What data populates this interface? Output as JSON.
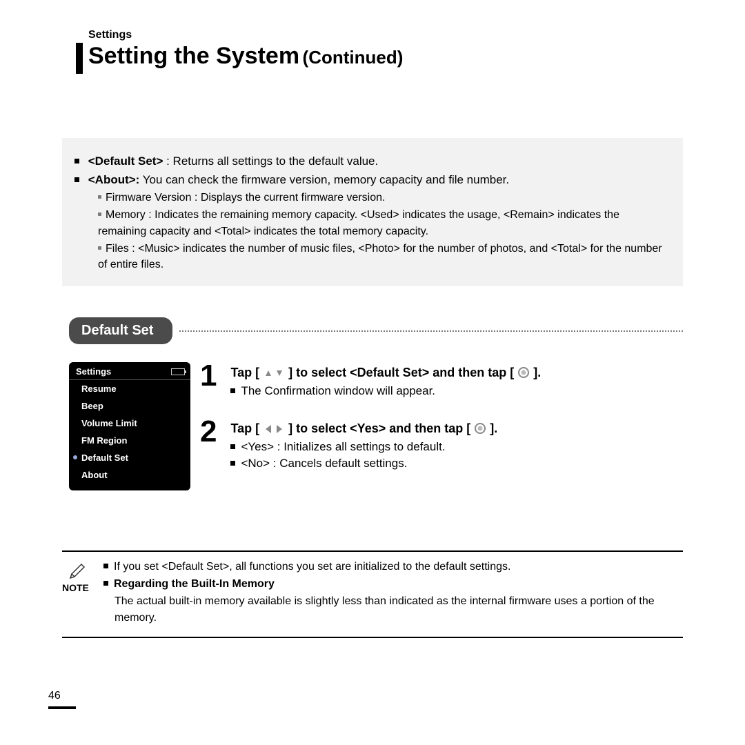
{
  "header": {
    "section_label": "Settings",
    "title_main": "Setting the System",
    "title_continued": "(Continued)"
  },
  "info_box": {
    "items": [
      {
        "bold": "<Default Set>",
        "plain": " : Returns all settings to the default value."
      },
      {
        "bold": "<About>:",
        "plain": " You can check the firmware version, memory capacity and file number."
      }
    ],
    "sub_items": [
      "Firmware Version : Displays the current firmware version.",
      "Memory : Indicates the remaining memory capacity. <Used> indicates the usage, <Remain> indicates the remaining capacity and <Total> indicates the total memory capacity.",
      "Files : <Music> indicates the number of music files, <Photo> for the number of photos, and <Total> for the number of entire files."
    ]
  },
  "section_tab": "Default Set",
  "device": {
    "title": "Settings",
    "items": [
      "Resume",
      "Beep",
      "Volume Limit",
      "FM Region",
      "Default Set",
      "About"
    ],
    "selected_index": 4
  },
  "steps": [
    {
      "num": "1",
      "head_pre": "Tap [ ",
      "head_mid": " ] to select <Default Set> and then tap [ ",
      "head_post": " ].",
      "icons": "updown",
      "subs": [
        "The Confirmation window will appear."
      ]
    },
    {
      "num": "2",
      "head_pre": "Tap [ ",
      "head_mid": " ] to select <Yes> and then tap [ ",
      "head_post": " ].",
      "icons": "leftright",
      "subs": [
        "<Yes> :  Initializes all settings to default.",
        "<No> : Cancels default settings."
      ]
    }
  ],
  "note": {
    "label": "NOTE",
    "rows": [
      {
        "type": "plain",
        "text": "If you set <Default Set>, all functions you set are initialized to the default settings."
      },
      {
        "type": "bold",
        "text": "Regarding the Built-In Memory"
      },
      {
        "type": "wrap",
        "text": "The actual built-in memory available is slightly less than indicated as the internal firmware uses a portion of the memory."
      }
    ]
  },
  "page_number": "46"
}
